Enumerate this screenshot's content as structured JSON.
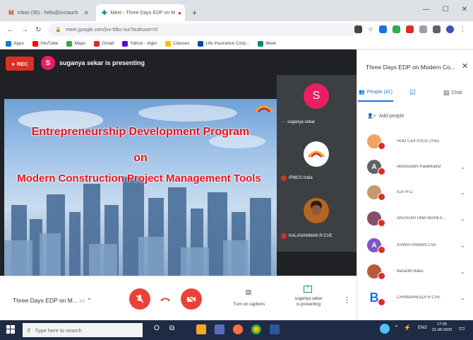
{
  "browser": {
    "tabs": [
      {
        "label": "Inbox (35) - hello@iccrauch",
        "icon": "gmail-icon"
      },
      {
        "label": "Meet - Three Days EDP on M",
        "icon": "meet-icon"
      }
    ],
    "new_tab": "+",
    "url": "meet.google.com/jvx-fdbc-iux?authuser=0",
    "bookmarks": [
      "Apps",
      "YouTube",
      "Maps",
      "Gmail",
      "Yahoo - login",
      "Classes",
      "Life Insurance Corp...",
      "Meet"
    ]
  },
  "meet": {
    "rec_label": "REC",
    "presenter_initial": "S",
    "presenter_text": "suganya sekar is presenting",
    "slide": {
      "line1": "Entrepreneurship Development Program",
      "line2": "on",
      "line3": "Modern Construction Project Management Tools",
      "logo_text": "IPMCS"
    },
    "tiles": [
      {
        "initial": "S",
        "name": "suganya sekar"
      },
      {
        "initial": "",
        "name": "IPMCS India"
      },
      {
        "initial": "",
        "name": "KALAIVANNAN R CVE"
      }
    ],
    "bottom": {
      "meeting_name": "Three Days EDP on M...",
      "captions_label": "Turn on captions",
      "presenting_label_1": "suganya sekar",
      "presenting_label_2": "is presenting"
    }
  },
  "panel": {
    "title": "Three Days EDP on Modern Co...",
    "tabs": [
      "People (41)",
      "",
      "Chat"
    ],
    "add_people": "Add people",
    "people": [
      {
        "name": "HOD Civil SVCE (You)",
        "initial": "",
        "color": "#f4a261"
      },
      {
        "name": "Abdussalim Kalakkadar",
        "initial": "A",
        "color": "#5f6368"
      },
      {
        "name": "AJITH C",
        "initial": "",
        "color": "#c49a6c"
      },
      {
        "name": "ANUSURI UMA MAHES...",
        "initial": "",
        "color": "#8b4d6b"
      },
      {
        "name": "ASWATHAMAN CVE",
        "initial": "A",
        "color": "#7e57c2"
      },
      {
        "name": "Basanth Babu",
        "initial": "",
        "color": "#b55d3a"
      },
      {
        "name": "CHINNAREDDI R CVE",
        "initial": "B",
        "color": "#1a73e8"
      }
    ]
  },
  "taskbar": {
    "search_placeholder": "Type here to search",
    "time": "17:00",
    "date": "21-08-2020",
    "lang": "ENG"
  }
}
